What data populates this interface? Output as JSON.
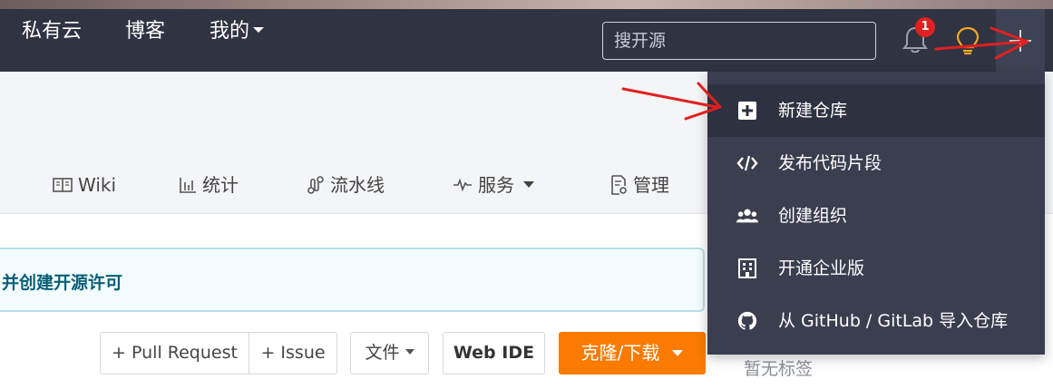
{
  "navbar": {
    "links": [
      {
        "label": "私有云"
      },
      {
        "label": "博客"
      },
      {
        "label": "我的"
      }
    ],
    "search": {
      "placeholder": "搜开源"
    },
    "notification_count": "1"
  },
  "tabs": [
    {
      "label": "Wiki",
      "icon": "book-icon"
    },
    {
      "label": "统计",
      "icon": "bar-chart-icon"
    },
    {
      "label": "流水线",
      "icon": "pipeline-icon"
    },
    {
      "label": "服务",
      "icon": "activity-icon"
    },
    {
      "label": "管理",
      "icon": "settings-doc-icon"
    }
  ],
  "notice": {
    "text": "并创建开源许可"
  },
  "actions": {
    "pull_request": "+ Pull Request",
    "issue": "+ Issue",
    "files": "文件",
    "web_ide": "Web IDE",
    "clone": "克隆/下载"
  },
  "sidebar": {
    "no_tags": "暂无标签"
  },
  "dropdown": {
    "items": [
      {
        "label": "新建仓库",
        "icon": "plus-square-icon"
      },
      {
        "label": "发布代码片段",
        "icon": "code-icon"
      },
      {
        "label": "创建组织",
        "icon": "users-icon"
      },
      {
        "label": "开通企业版",
        "icon": "building-icon"
      },
      {
        "label": "从 GitHub / GitLab 导入仓库",
        "icon": "github-icon"
      }
    ]
  },
  "colors": {
    "navbar": "#2f3342",
    "dropdown": "#3a3e4e",
    "clone_button": "#fa7b00",
    "annotation_arrow": "#e02020"
  }
}
